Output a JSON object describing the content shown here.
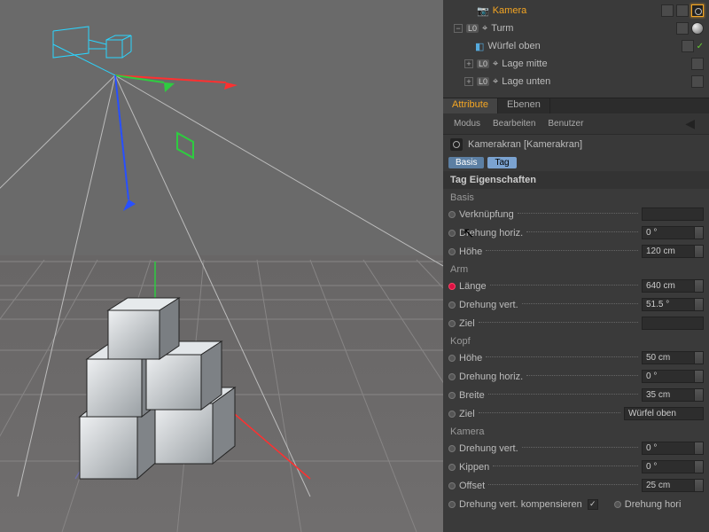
{
  "hierarchy": {
    "camera_label": "Kamera",
    "tower_label": "Turm",
    "cube_top_label": "Würfel oben",
    "layer_mid_label": "Lage mitte",
    "layer_bottom_label": "Lage unten",
    "l0": "L0"
  },
  "panel_tabs": {
    "attributes": "Attribute",
    "layers": "Ebenen"
  },
  "menubar": {
    "mode": "Modus",
    "edit": "Bearbeiten",
    "user": "Benutzer"
  },
  "object_header": "Kamerakran [Kamerakran]",
  "subtabs": {
    "base": "Basis",
    "tag": "Tag"
  },
  "sections": {
    "tag_props": "Tag Eigenschaften",
    "basis": "Basis",
    "arm": "Arm",
    "head": "Kopf",
    "camera": "Kamera"
  },
  "props": {
    "link": "Verknüpfung",
    "rot_h": {
      "label": "Drehung horiz.",
      "value": "0 °"
    },
    "height": {
      "label": "Höhe",
      "value": "120 cm"
    },
    "length": {
      "label": "Länge",
      "value": "640 cm"
    },
    "rot_v": {
      "label": "Drehung vert.",
      "value": "51.5 °"
    },
    "target": "Ziel",
    "head_height": {
      "label": "Höhe",
      "value": "50 cm"
    },
    "head_rot_h": {
      "label": "Drehung horiz.",
      "value": "0 °"
    },
    "width": {
      "label": "Breite",
      "value": "35 cm"
    },
    "head_target": {
      "label": "Ziel",
      "value": "Würfel oben"
    },
    "cam_rot_v": {
      "label": "Drehung vert.",
      "value": "0 °"
    },
    "tilt": {
      "label": "Kippen",
      "value": "0 °"
    },
    "offset": {
      "label": "Offset",
      "value": "25 cm"
    },
    "comp_v": "Drehung vert. kompensieren",
    "comp_h": "Drehung hori"
  }
}
